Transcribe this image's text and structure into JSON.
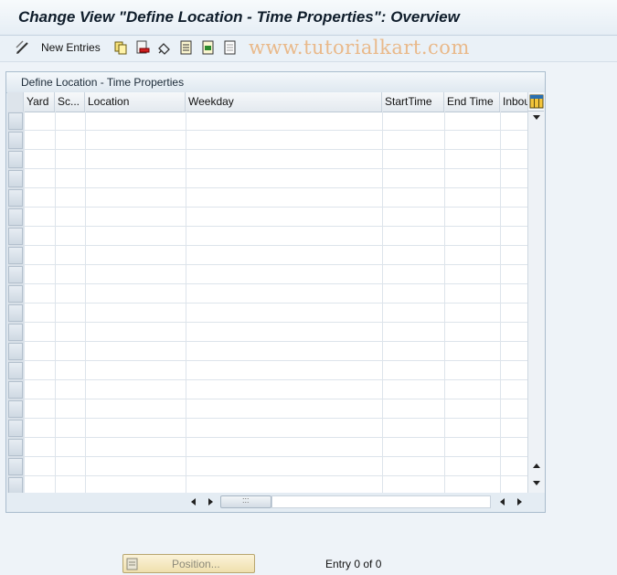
{
  "window": {
    "title": "Change View \"Define Location - Time Properties\": Overview"
  },
  "toolbar": {
    "new_entries_label": "New Entries",
    "icons": [
      "edit-pencil-icon",
      "copy-icon",
      "delete-icon",
      "undo-icon",
      "select-all-icon",
      "select-block-icon",
      "deselect-all-icon"
    ]
  },
  "watermark": "www.tutorialkart.com",
  "panel": {
    "title": "Define Location - Time Properties"
  },
  "table": {
    "columns": [
      "Yard",
      "Sc...",
      "Location",
      "Weekday",
      "StartTime",
      "End Time",
      "Inbou"
    ],
    "row_count": 20
  },
  "footer": {
    "position_label": "Position...",
    "entry_info": "Entry 0 of 0"
  },
  "colors": {
    "background": "#eef3f8",
    "title_text": "#0f1d2b",
    "position_button": "#efe0ad",
    "watermark": "#e9b98a"
  }
}
